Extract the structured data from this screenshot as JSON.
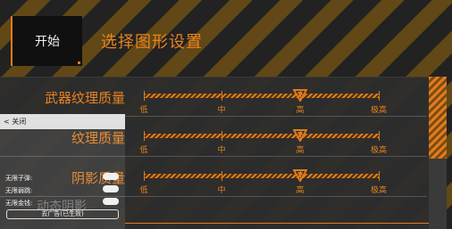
{
  "header": {
    "start_label": "开始",
    "title": "选择图形设置"
  },
  "settings": {
    "rows": [
      {
        "label": "武器纹理质量",
        "level": "高",
        "ticks": [
          "低",
          "中",
          "高",
          "极高"
        ]
      },
      {
        "label": "纹理质量",
        "level": "高",
        "ticks": [
          "低",
          "中",
          "高",
          "极高"
        ]
      },
      {
        "label": "阴影质量",
        "level": "高",
        "ticks": [
          "低",
          "中",
          "高",
          "极高"
        ]
      },
      {
        "label": "动态阴影"
      }
    ]
  },
  "cheat_menu": {
    "close_label": "< 关闭",
    "options": [
      {
        "label": "无限子弹:",
        "enabled": true
      },
      {
        "label": "无限弱跳:",
        "enabled": true
      },
      {
        "label": "无限金钱:",
        "enabled": true
      }
    ],
    "ad_button_label": "去广告(已生效)"
  },
  "colors": {
    "accent": "#e8831f",
    "panel": "#2d2d2d"
  },
  "icons": {
    "thumb": "triangle-marker-icon"
  }
}
